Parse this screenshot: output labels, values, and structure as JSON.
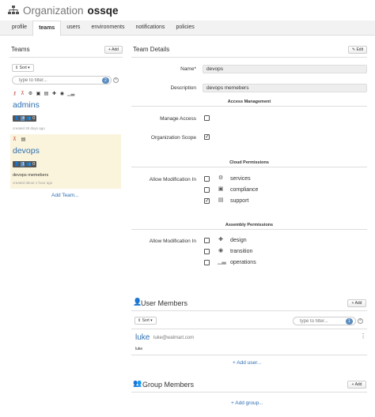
{
  "header": {
    "org_label": "Organization",
    "org_name": "ossqe"
  },
  "tabs": [
    {
      "label": "profile"
    },
    {
      "label": "teams"
    },
    {
      "label": "users"
    },
    {
      "label": "environments"
    },
    {
      "label": "notifications"
    },
    {
      "label": "policies"
    }
  ],
  "active_tab": "teams",
  "teams_panel": {
    "title": "Teams",
    "add_label": "+ Add",
    "sort_label": "⇕ Sort ▾",
    "filter_placeholder": "type to filter...",
    "filter_count": "2",
    "teams": [
      {
        "name": "admins",
        "users_count": "4",
        "groups_count": "0",
        "meta": "created 29 days ago",
        "description": ""
      },
      {
        "name": "devops",
        "users_count": "1",
        "groups_count": "0",
        "meta": "created about 1 hour ago",
        "description": "devops memebers"
      }
    ],
    "add_team_label": "Add Team..."
  },
  "team_details": {
    "title": "Team Details",
    "edit_label": "✎ Edit",
    "name_label": "Name*",
    "name_value": "devops",
    "description_label": "Description",
    "description_value": "devops memebers",
    "access_management": {
      "heading": "Access Management",
      "manage_access_label": "Manage Access",
      "manage_access_checked": false,
      "org_scope_label": "Organization Scope",
      "org_scope_checked": true
    },
    "cloud_permissions": {
      "heading": "Cloud Permissions",
      "allow_label": "Allow Modification In",
      "options": [
        {
          "label": "services",
          "icon": "gear-icon",
          "checked": false
        },
        {
          "label": "compliance",
          "icon": "id-card-icon",
          "checked": false
        },
        {
          "label": "support",
          "icon": "briefcase-icon",
          "checked": true
        }
      ]
    },
    "assembly_permissions": {
      "heading": "Assembly Permissions",
      "allow_label": "Allow Modification In",
      "options": [
        {
          "label": "design",
          "icon": "puzzle-icon",
          "checked": false
        },
        {
          "label": "transition",
          "icon": "target-icon",
          "checked": false
        },
        {
          "label": "operations",
          "icon": "signal-bars-icon",
          "checked": false
        }
      ]
    }
  },
  "user_members": {
    "title": "User Members",
    "add_label": "+ Add",
    "sort_label": "⇕ Sort ▾",
    "filter_placeholder": "type to filter...",
    "filter_count": "1",
    "members": [
      {
        "name": "luke",
        "email": "luke@walmart.com",
        "username": "luke"
      }
    ],
    "add_user_label": "+ Add user..."
  },
  "group_members": {
    "title": "Group Members",
    "add_label": "+ Add",
    "add_group_label": "+ Add group..."
  },
  "colors": {
    "link": "#2d6fb3",
    "badge": "#5b8dbf",
    "selected_row": "#fbf4dc"
  }
}
